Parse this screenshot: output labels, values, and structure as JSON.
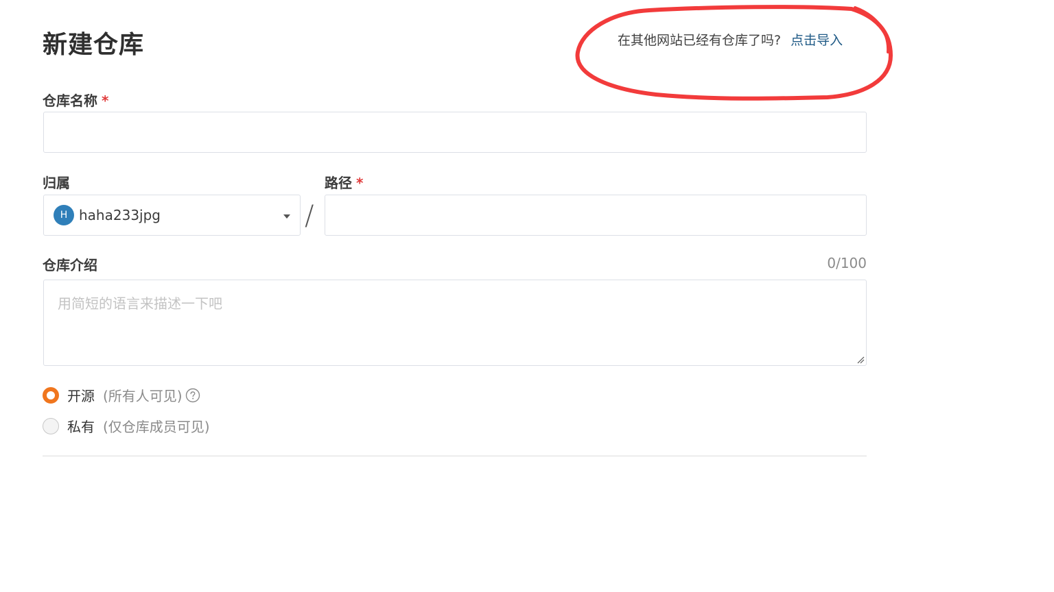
{
  "page": {
    "title": "新建仓库"
  },
  "import": {
    "question": "在其他网站已经有仓库了吗?",
    "link": "点击导入"
  },
  "annotation": {
    "color": "#f23b3b"
  },
  "form": {
    "name": {
      "label": "仓库名称",
      "required_mark": "*",
      "value": ""
    },
    "owner": {
      "label": "归属",
      "avatar_letter": "H",
      "value": "haha233jpg"
    },
    "separator": "/",
    "path": {
      "label": "路径",
      "required_mark": "*",
      "value": ""
    },
    "description": {
      "label": "仓库介绍",
      "counter": "0/100",
      "placeholder": "用简短的语言来描述一下吧"
    },
    "visibility": {
      "options": [
        {
          "label": "开源",
          "sub": "(所有人可见)",
          "checked": true,
          "icon": "help-icon"
        },
        {
          "label": "私有",
          "sub": "(仅仓库成员可见)",
          "checked": false
        }
      ]
    }
  },
  "colors": {
    "accent": "#f0761e",
    "link": "#1f5a86",
    "avatar": "#2f7fb9",
    "required": "#e03a3a"
  }
}
